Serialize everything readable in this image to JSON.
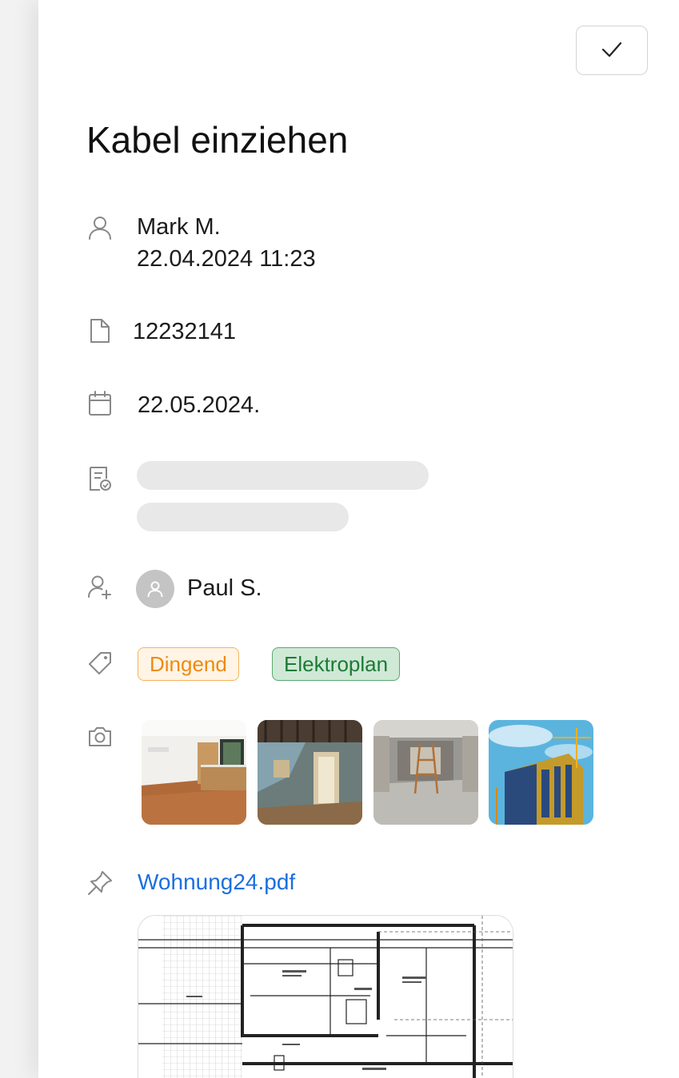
{
  "header": {
    "title": "Kabel einziehen",
    "confirm_icon": "check-icon"
  },
  "creator": {
    "name": "Mark M.",
    "datetime": "22.04.2024 11:23",
    "icon": "user-icon"
  },
  "document": {
    "number": "12232141",
    "icon": "file-icon"
  },
  "due_date": {
    "value": "22.05.2024.",
    "icon": "calendar-icon"
  },
  "checklist": {
    "icon": "checklist-icon",
    "state": "loading"
  },
  "assignee": {
    "name": "Paul S.",
    "icon": "assign-user-icon"
  },
  "tags": {
    "icon": "tag-icon",
    "items": [
      {
        "label": "Dingend",
        "color": "#ee8a10"
      },
      {
        "label": "Elektroplan",
        "color": "#1d7a35"
      }
    ]
  },
  "photos": {
    "icon": "camera-icon",
    "items": [
      "kitchen-photo",
      "renovation-room-photo",
      "construction-room-photo",
      "building-facade-photo"
    ]
  },
  "attachment": {
    "icon": "pin-icon",
    "filename": "Wohnung24.pdf"
  }
}
